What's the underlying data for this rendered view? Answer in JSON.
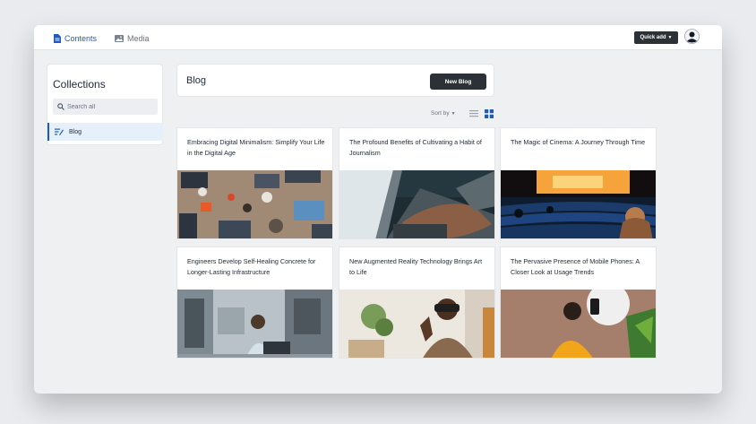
{
  "topbar": {
    "nav": [
      {
        "label": "Contents",
        "icon": "document-icon",
        "active": true
      },
      {
        "label": "Media",
        "icon": "image-icon",
        "active": false
      }
    ],
    "quick_add_label": "Quick add",
    "avatar_icon": "user-avatar-icon"
  },
  "sidebar": {
    "title": "Collections",
    "search_placeholder": "Search all",
    "items": [
      {
        "label": "Blog",
        "icon": "blog-icon",
        "selected": true
      }
    ]
  },
  "main": {
    "title": "Blog",
    "new_button_label": "New Blog",
    "sort_label": "Sort by",
    "view_modes": [
      "list-view-icon",
      "grid-view-icon"
    ],
    "active_view": "grid",
    "cards": [
      {
        "title": "Embracing Digital Minimalism: Simplify Your Life in the Digital Age",
        "image": "desks-with-laptops-photo"
      },
      {
        "title": "The Profound Benefits of Cultivating a Habit of Journalism",
        "image": "typing-on-laptop-photo"
      },
      {
        "title": "The Magic of Cinema: A Journey Through Time",
        "image": "cinema-theater-photo"
      },
      {
        "title": "Engineers Develop Self-Healing Concrete for Longer-Lasting Infrastructure",
        "image": "lab-engineer-photo"
      },
      {
        "title": "New Augmented Reality Technology Brings Art to Life",
        "image": "vr-headset-photo"
      },
      {
        "title": "The Pervasive Presence of Mobile Phones: A Closer Look at Usage Trends",
        "image": "woman-with-phone-photo"
      }
    ]
  },
  "colors": {
    "accent": "#1f5bbd",
    "dark_button": "#2b3136",
    "selected_bg": "#e6f0fb",
    "page_bg": "#eff0f2"
  }
}
